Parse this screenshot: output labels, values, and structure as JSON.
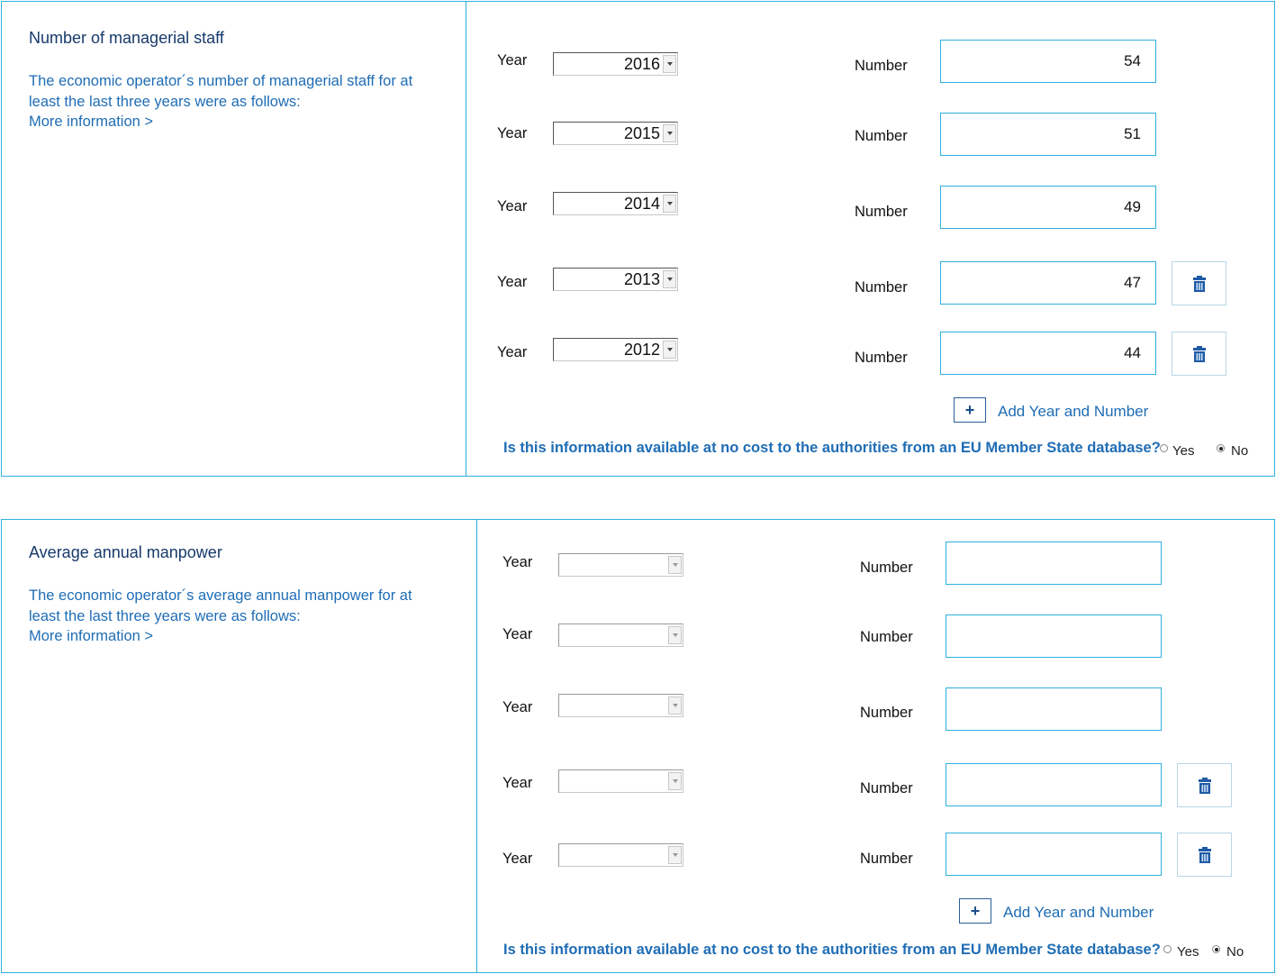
{
  "sections": [
    {
      "title": "Number of managerial staff",
      "description": "The economic operator´s number of managerial staff for at least the last three years were as follows:",
      "more_link": "More information >",
      "rows": [
        {
          "year_label": "Year",
          "year": "2016",
          "number_label": "Number",
          "number": "54"
        },
        {
          "year_label": "Year",
          "year": "2015",
          "number_label": "Number",
          "number": "51"
        },
        {
          "year_label": "Year",
          "year": "2014",
          "number_label": "Number",
          "number": "49"
        },
        {
          "year_label": "Year",
          "year": "2013",
          "number_label": "Number",
          "number": "47"
        },
        {
          "year_label": "Year",
          "year": "2012",
          "number_label": "Number",
          "number": "44"
        }
      ],
      "add_label": "Add Year and Number",
      "question": "Is this information available at no cost to the authorities from an EU Member State database?",
      "radio_yes": "Yes",
      "radio_no": "No",
      "selected": "No"
    },
    {
      "title": "Average annual manpower",
      "description": "The economic operator´s average annual manpower for at least the last three years were as follows:",
      "more_link": "More information >",
      "rows": [
        {
          "year_label": "Year",
          "year": "",
          "number_label": "Number",
          "number": ""
        },
        {
          "year_label": "Year",
          "year": "",
          "number_label": "Number",
          "number": ""
        },
        {
          "year_label": "Year",
          "year": "",
          "number_label": "Number",
          "number": ""
        },
        {
          "year_label": "Year",
          "year": "",
          "number_label": "Number",
          "number": ""
        },
        {
          "year_label": "Year",
          "year": "",
          "number_label": "Number",
          "number": ""
        }
      ],
      "add_label": "Add Year and Number",
      "question": "Is this information available at no cost to the authorities from an EU Member State database?",
      "radio_yes": "Yes",
      "radio_no": "No",
      "selected": "No"
    }
  ],
  "colors": {
    "border": "#2fb0dd",
    "link": "#1f6db5",
    "title": "#173a6b"
  },
  "icons": {
    "delete": "trash-icon",
    "add": "plus-icon",
    "dropdown": "chevron-down-icon"
  }
}
